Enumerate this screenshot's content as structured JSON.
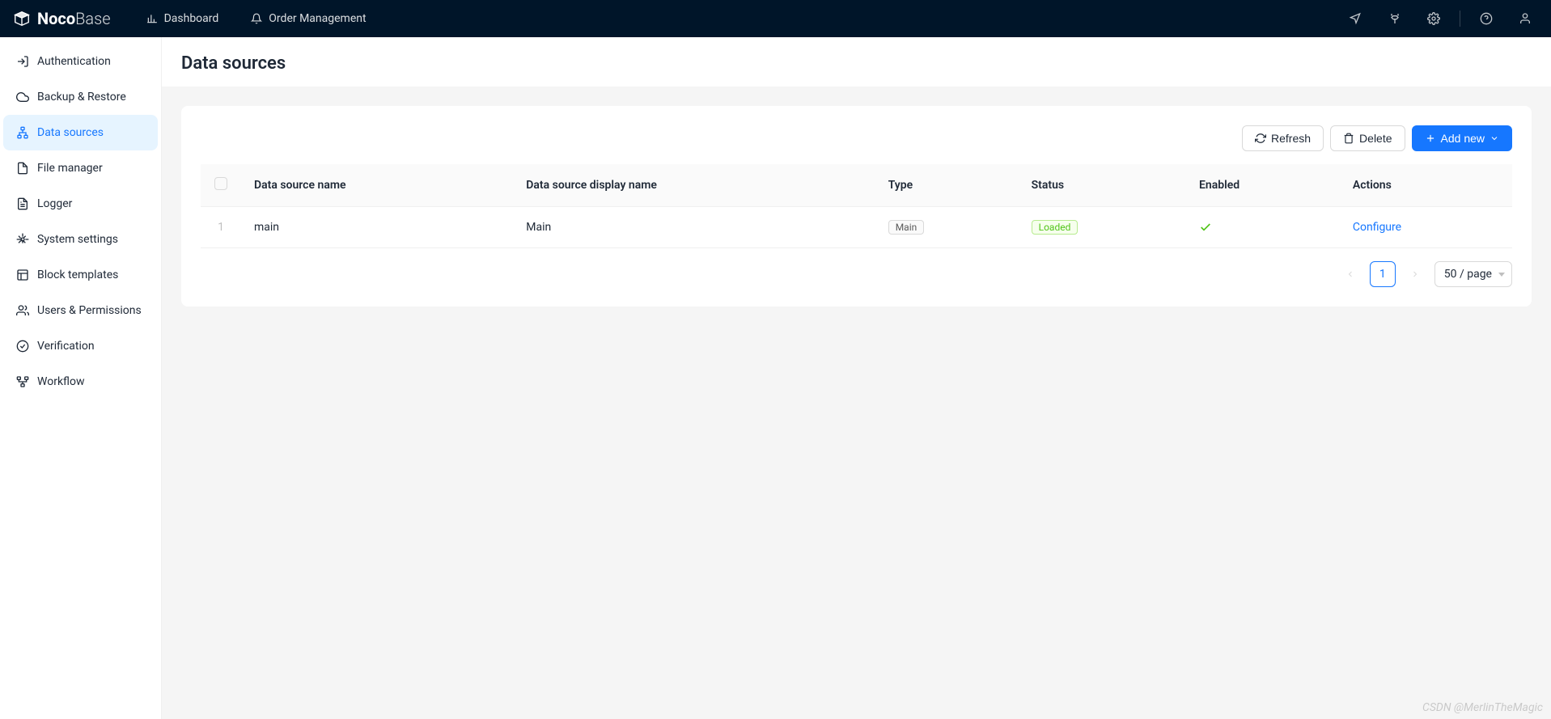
{
  "brand": {
    "bold": "Noco",
    "light": "Base"
  },
  "nav": {
    "items": [
      {
        "label": "Dashboard",
        "icon": "bar-chart"
      },
      {
        "label": "Order Management",
        "icon": "bell"
      }
    ]
  },
  "sidebar": {
    "items": [
      {
        "label": "Authentication",
        "icon": "login",
        "active": false
      },
      {
        "label": "Backup & Restore",
        "icon": "cloud",
        "active": false
      },
      {
        "label": "Data sources",
        "icon": "cluster",
        "active": true
      },
      {
        "label": "File manager",
        "icon": "file",
        "active": false
      },
      {
        "label": "Logger",
        "icon": "file-text",
        "active": false
      },
      {
        "label": "System settings",
        "icon": "setting",
        "active": false
      },
      {
        "label": "Block templates",
        "icon": "layout",
        "active": false
      },
      {
        "label": "Users & Permissions",
        "icon": "team",
        "active": false
      },
      {
        "label": "Verification",
        "icon": "check-circle",
        "active": false
      },
      {
        "label": "Workflow",
        "icon": "partition",
        "active": false
      }
    ]
  },
  "page": {
    "title": "Data sources"
  },
  "toolbar": {
    "refresh": "Refresh",
    "delete": "Delete",
    "add_new": "Add new"
  },
  "table": {
    "headers": {
      "name": "Data source name",
      "display": "Data source display name",
      "type": "Type",
      "status": "Status",
      "enabled": "Enabled",
      "actions": "Actions"
    },
    "rows": [
      {
        "index": "1",
        "name": "main",
        "display": "Main",
        "type": "Main",
        "status": "Loaded",
        "enabled": true,
        "action": "Configure"
      }
    ]
  },
  "pagination": {
    "current": "1",
    "page_size": "50 / page"
  },
  "watermark": "CSDN @MerlinTheMagic"
}
